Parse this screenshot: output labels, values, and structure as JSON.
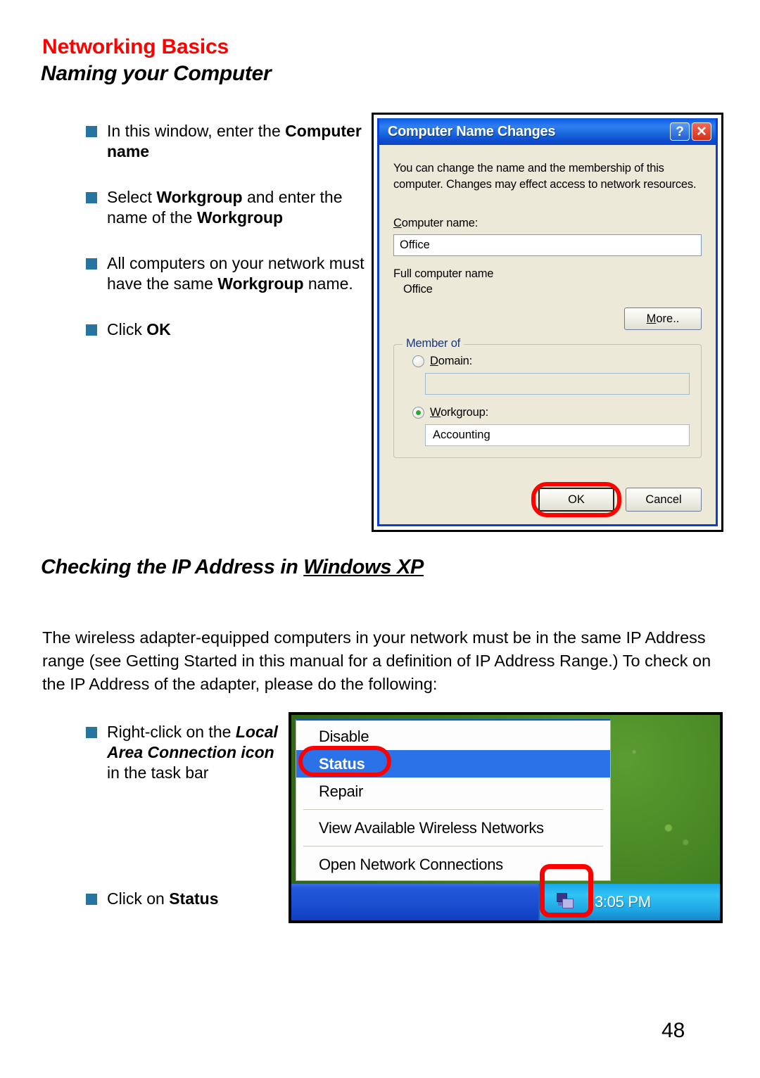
{
  "page": {
    "title": "Networking Basics",
    "subtitle": "Naming your Computer",
    "number": "48"
  },
  "bullets_top": [
    {
      "html": "In this window, enter the <b>Computer name</b>"
    },
    {
      "html": "Select <b>Workgroup</b> and enter the name of the <b>Workgroup</b>"
    },
    {
      "html": "All computers on your network must have the same <b>Workgroup</b> name."
    },
    {
      "html": "Click <b>OK</b>"
    }
  ],
  "section": {
    "heading_prefix": "Checking the IP Address in ",
    "heading_underlined": "Windows XP",
    "paragraph": "The wireless adapter-equipped computers in your network must be in the same IP Address range (see Getting Started in this manual for a definition of IP Address Range.) To check on the IP Address of the adapter, please do the following:"
  },
  "bullets_bottom": [
    {
      "html": "Right-click on the <i class=\"bi\">Local Area Connection icon</i> in the task bar"
    },
    {
      "html": "Click on <b>Status</b>"
    }
  ],
  "dialog": {
    "title": "Computer Name Changes",
    "help_button": "?",
    "close_button": "✕",
    "description": "You can change the name and the membership of this computer. Changes may effect access to network resources.",
    "computer_name_label": "Computer name:",
    "computer_name_value": "Office",
    "full_computer_name_label": "Full computer name",
    "full_computer_name_value": "Office",
    "more_button": "More..",
    "group_title": "Member of",
    "domain_label": "Domain:",
    "domain_value": "",
    "domain_selected": false,
    "workgroup_label": "Workgroup:",
    "workgroup_value": "Accounting",
    "workgroup_selected": true,
    "ok_button": "OK",
    "cancel_button": "Cancel",
    "highlight_color": "#ff0000"
  },
  "context_menu": {
    "items": [
      {
        "label": "Disable",
        "highlighted": false
      },
      {
        "label": "Status",
        "highlighted": true
      },
      {
        "label": "Repair",
        "highlighted": false
      },
      {
        "label": "View Available Wireless Networks",
        "highlighted": false
      },
      {
        "label": "Open Network Connections",
        "highlighted": false
      }
    ],
    "highlight_color": "#2b72e8",
    "taskbar_time": "3:05 PM",
    "tray_icon": "network-connection-icon"
  }
}
